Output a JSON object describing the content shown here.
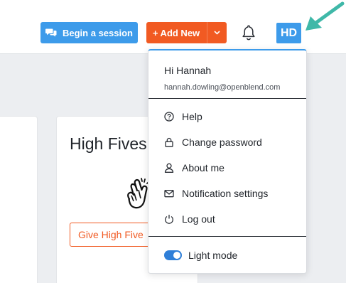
{
  "header": {
    "session_button": "Begin a session",
    "add_button": "+ Add New",
    "avatar_initials": "HD"
  },
  "card": {
    "title": "High Fives",
    "give_button": "Give High Five"
  },
  "dropdown": {
    "greeting": "Hi Hannah",
    "email": "hannah.dowling@openblend.com",
    "items": [
      {
        "label": "Help",
        "icon": "help-circle-icon"
      },
      {
        "label": "Change password",
        "icon": "lock-icon"
      },
      {
        "label": "About me",
        "icon": "user-icon"
      },
      {
        "label": "Notification settings",
        "icon": "envelope-icon"
      },
      {
        "label": "Log out",
        "icon": "power-icon"
      }
    ],
    "light_mode_label": "Light mode",
    "light_mode_on": true
  },
  "colors": {
    "accent_blue": "#3d9bea",
    "accent_orange": "#f15a22",
    "annotation_arrow": "#3fb8a8"
  }
}
